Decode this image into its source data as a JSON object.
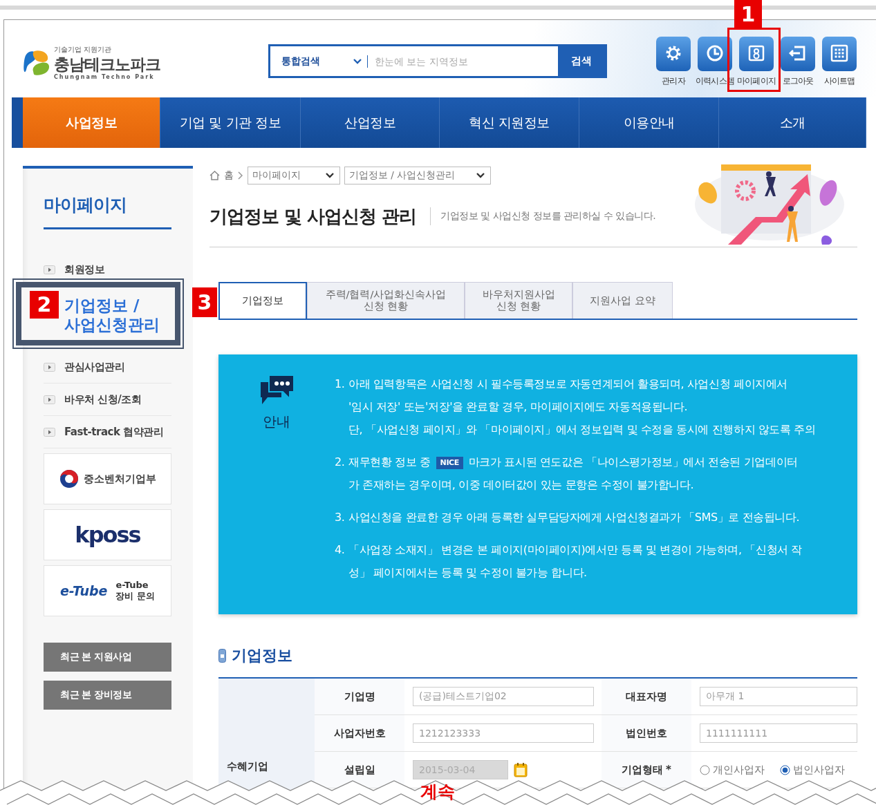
{
  "header": {
    "logo": {
      "tagline": "기술기업 지원기관",
      "name": "충남테크노파크",
      "subtitle": "Chungnam Techno Park"
    },
    "search": {
      "scope": "통합검색",
      "placeholder": "한눈에 보는 지역정보",
      "button": "검색"
    },
    "utility_links": [
      {
        "kind": "gear",
        "label": "관리자"
      },
      {
        "kind": "clock",
        "label": "이력시스템"
      },
      {
        "kind": "person",
        "label": "마이페이지"
      },
      {
        "kind": "logout",
        "label": "로그아웃"
      },
      {
        "kind": "grid",
        "label": "사이트맵"
      }
    ]
  },
  "nav": [
    {
      "label": "사업정보",
      "selected": true
    },
    {
      "label": "기업 및 기관 정보",
      "selected": false
    },
    {
      "label": "산업정보",
      "selected": false
    },
    {
      "label": "혁신 지원정보",
      "selected": false
    },
    {
      "label": "이용안내",
      "selected": false
    },
    {
      "label": "소개",
      "selected": false
    }
  ],
  "sidebar": {
    "title": "마이페이지",
    "items": [
      {
        "label": "회원정보",
        "selected": false
      },
      {
        "label": "기업정보 / 사업신청관리",
        "selected": true
      },
      {
        "label": "관심사업관리",
        "selected": false
      },
      {
        "label": "바우처 신청/조회",
        "selected": false
      },
      {
        "label": "Fast-track 협약관리",
        "selected": false
      }
    ],
    "partners": [
      {
        "kind": "mss",
        "label": "중소벤처기업부"
      },
      {
        "kind": "kposs",
        "label": "kposs"
      },
      {
        "kind": "etube",
        "label": "e-Tube",
        "caption": [
          "e-Tube",
          "장비 문의"
        ]
      }
    ],
    "recent_buttons": [
      "최근 본 지원사업",
      "최근 본 장비정보"
    ]
  },
  "breadcrumb": {
    "home": "홈",
    "selects": [
      "마이페이지",
      "기업정보 / 사업신청관리"
    ]
  },
  "page_title": "기업정보 및 사업신청 관리",
  "page_description": "기업정보 및 사업신청 정보를 관리하실 수 있습니다.",
  "tabs": [
    {
      "lines": [
        "기업정보"
      ],
      "selected": true
    },
    {
      "lines": [
        "주력/협력/사업화신속사업",
        "신청 현황"
      ],
      "selected": false
    },
    {
      "lines": [
        "바우처지원사업",
        "신청 현황"
      ],
      "selected": false
    },
    {
      "lines": [
        "지원사업 요약"
      ],
      "selected": false
    }
  ],
  "notice": {
    "label": "안내",
    "items": [
      {
        "number": "1.",
        "lines": [
          {
            "text": "아래 입력항목은 사업신청 시 필수등록정보로 자동연계되어 활용되며, 사업신청 페이지에서"
          },
          {
            "text": "'임시 저장' 또는'저장'을 완료할 경우, 마이페이지에도 자동적용됩니다."
          },
          {
            "text": "단, 「사업신청 페이지」와 「마이페이지」에서 정보입력 및 수정을 동시에 진행하지 않도록 주의"
          }
        ]
      },
      {
        "number": "2.",
        "lines": [
          {
            "text": "재무현황 정보 중",
            "badge": "NICE",
            "text_after": "마크가 표시된 연도값은 「나이스평가정보」에서 전송된 기업데이터"
          },
          {
            "text": "가 존재하는 경우이며, 이중 데이터값이 있는 문항은 수정이 불가합니다."
          }
        ]
      },
      {
        "number": "3.",
        "lines": [
          {
            "text": "사업신청을 완료한 경우 아래 등록한 실무담당자에게 사업신청결과가 「SMS」로 전송됩니다."
          }
        ]
      },
      {
        "number": "4.",
        "lines": [
          {
            "text": "「사업장 소재지」 변경은 본 페이지(마이페이지)에서만 등록 및 변경이 가능하며, 「신청서 작"
          },
          {
            "text": "성」 페이지에서는 등록 및 수정이 불가능 합니다."
          }
        ]
      }
    ]
  },
  "section_title": "기업정보",
  "company_form": {
    "group_label": "수혜기업",
    "rows": [
      [
        {
          "label": "기업명",
          "kind": "text",
          "value": "(공급)테스트기업02"
        },
        {
          "label": "대표자명",
          "kind": "text",
          "value": "아무개 1"
        }
      ],
      [
        {
          "label": "사업자번호",
          "kind": "text",
          "value": "1212123333"
        },
        {
          "label": "법인번호",
          "kind": "text",
          "value": "1111111111"
        }
      ],
      [
        {
          "label": "설립일",
          "kind": "date",
          "value": "2015-03-04",
          "disabled": true
        },
        {
          "label": "기업형태",
          "required_mark": "*",
          "kind": "radio",
          "options": [
            {
              "label": "개인사업자",
              "selected": false
            },
            {
              "label": "법인사업자",
              "selected": true
            }
          ]
        }
      ]
    ]
  },
  "annotations": {
    "markers": [
      {
        "label": "1"
      },
      {
        "label": "2"
      },
      {
        "label": "3"
      }
    ],
    "continue_label": "계속"
  }
}
